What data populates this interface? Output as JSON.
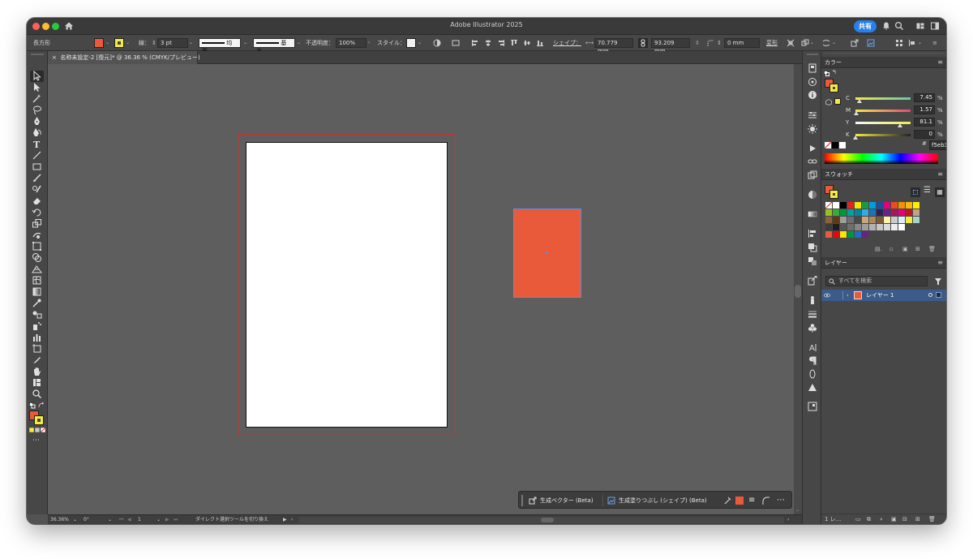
{
  "app": {
    "title": "Adobe Illustrator 2025",
    "share_label": "共有"
  },
  "control_bar": {
    "object_type": "長方形",
    "stroke_label": "線：",
    "stroke_weight": "3 pt",
    "profile_uniform": "均等",
    "brush_basic": "基本",
    "opacity_label": "不透明度：",
    "opacity_value": "100%",
    "style_label": "スタイル：",
    "shape_label": "シェイプ：",
    "width_value": "70.779 mm",
    "height_value": "93.209 mm",
    "corner_value": "0 mm",
    "transform_label": "変形"
  },
  "document_tab": {
    "close": "×",
    "title": "名称未設定-2 [復元]* @ 36.36 % (CMYK/プレビュー)"
  },
  "context_bar": {
    "gen_vector": "生成ベクター (Beta)",
    "gen_fill": "生成塗りつぶし (シェイプ) (Beta)",
    "more": "⋯"
  },
  "status_bar": {
    "zoom": "36.36%",
    "rotation": "0°",
    "artboard_number": "1",
    "tool_hint": "ダイレクト選択ツールを切り換え"
  },
  "color_panel": {
    "title": "カラー",
    "channels": [
      {
        "label": "C",
        "value": "7.45",
        "pct": "%",
        "fraction": 0.07
      },
      {
        "label": "M",
        "value": "1.57",
        "pct": "%",
        "fraction": 0.02
      },
      {
        "label": "Y",
        "value": "81.1",
        "pct": "%",
        "fraction": 0.81
      },
      {
        "label": "K",
        "value": "0",
        "pct": "%",
        "fraction": 0.0
      }
    ],
    "hex_label": "#",
    "hex_value": "f5eb3f"
  },
  "swatches_panel": {
    "title": "スウォッチ"
  },
  "layers_panel": {
    "title": "レイヤー",
    "search_placeholder": "すべてを検索",
    "layer_name": "レイヤー 1",
    "footer_count": "1 レ..."
  },
  "colors": {
    "fill": "#e85a39",
    "stroke": "#f5eb3f",
    "accent": "#2680eb",
    "selection": "#5c8de4"
  }
}
